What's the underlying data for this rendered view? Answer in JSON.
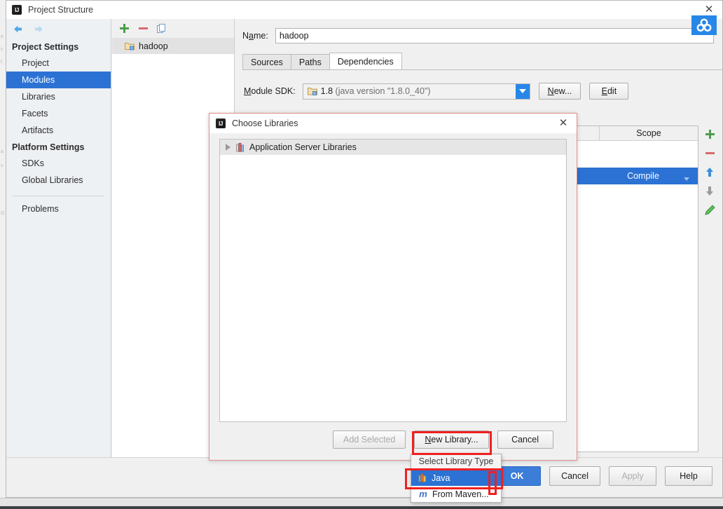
{
  "window": {
    "title": "Project Structure",
    "logo_text": "IJ",
    "close_label": "✕"
  },
  "collab_badge": {
    "name": "collaboration-icon"
  },
  "sidebar": {
    "back_icon": "back-arrow-icon",
    "forward_icon": "forward-arrow-icon",
    "groups": [
      {
        "label": "Project Settings",
        "items": [
          {
            "label": "Project",
            "selected": false
          },
          {
            "label": "Modules",
            "selected": true
          },
          {
            "label": "Libraries",
            "selected": false
          },
          {
            "label": "Facets",
            "selected": false
          },
          {
            "label": "Artifacts",
            "selected": false
          }
        ]
      },
      {
        "label": "Platform Settings",
        "items": [
          {
            "label": "SDKs",
            "selected": false
          },
          {
            "label": "Global Libraries",
            "selected": false
          }
        ]
      }
    ],
    "problems_label": "Problems",
    "selected_color": "#2b72d4"
  },
  "modules_panel": {
    "toolbar": {
      "add_icon": "plus-icon",
      "remove_icon": "minus-icon",
      "copy_icon": "copy-icon"
    },
    "items": [
      {
        "label": "hadoop",
        "icon": "module-folder-icon",
        "selected": true
      }
    ]
  },
  "module_editor": {
    "name_label_pre": "N",
    "name_label_mnemonic": "a",
    "name_label_post": "me:",
    "name_value": "hadoop",
    "name_placeholder": "",
    "tabs": [
      {
        "label": "Sources",
        "active": false
      },
      {
        "label": "Paths",
        "active": false
      },
      {
        "label": "Dependencies",
        "active": true
      }
    ],
    "sdk_label_pre": "M",
    "sdk_label_post": "odule SDK:",
    "sdk_value_version": "1.8",
    "sdk_value_detail": "(java version \"1.8.0_40\")",
    "sdk_new_button_pre": "N",
    "sdk_new_button_post": "ew...",
    "sdk_edit_button_pre": "E",
    "sdk_edit_button_post": "dit",
    "dependencies_table": {
      "columns": [
        "",
        "Scope"
      ],
      "rows": [
        {
          "name": "",
          "scope": "Compile",
          "selected": true
        }
      ]
    },
    "side_tools": [
      {
        "name": "add-dependency-icon"
      },
      {
        "name": "remove-dependency-icon"
      },
      {
        "name": "move-up-icon"
      },
      {
        "name": "move-down-icon"
      },
      {
        "name": "edit-dependency-icon"
      }
    ]
  },
  "choose_libraries_dialog": {
    "title": "Choose Libraries",
    "close_label": "✕",
    "tree": [
      {
        "label": "Application Server Libraries",
        "icon": "library-icon",
        "expandable": true,
        "selected": true
      }
    ],
    "buttons": {
      "add_selected": "Add Selected",
      "new_library_pre": "N",
      "new_library_post": "ew Library...",
      "cancel": "Cancel"
    }
  },
  "library_type_menu": {
    "header": "Select Library Type",
    "items": [
      {
        "label": "Java",
        "icon": "java-library-icon",
        "selected": true
      },
      {
        "label": "From Maven...",
        "icon": "maven-icon",
        "selected": false
      }
    ]
  },
  "bottom_buttons": {
    "ok": "OK",
    "cancel": "Cancel",
    "apply": "Apply",
    "help": "Help",
    "apply_disabled": true
  },
  "colors": {
    "accent_blue": "#2b72d4",
    "primary_button": "#3b7dd8",
    "annotation_red": "#f02020",
    "dialog_border": "#e38e8e"
  },
  "background_ghost": [
    "e",
    "c",
    "t",
    "a",
    "s",
    "G"
  ]
}
